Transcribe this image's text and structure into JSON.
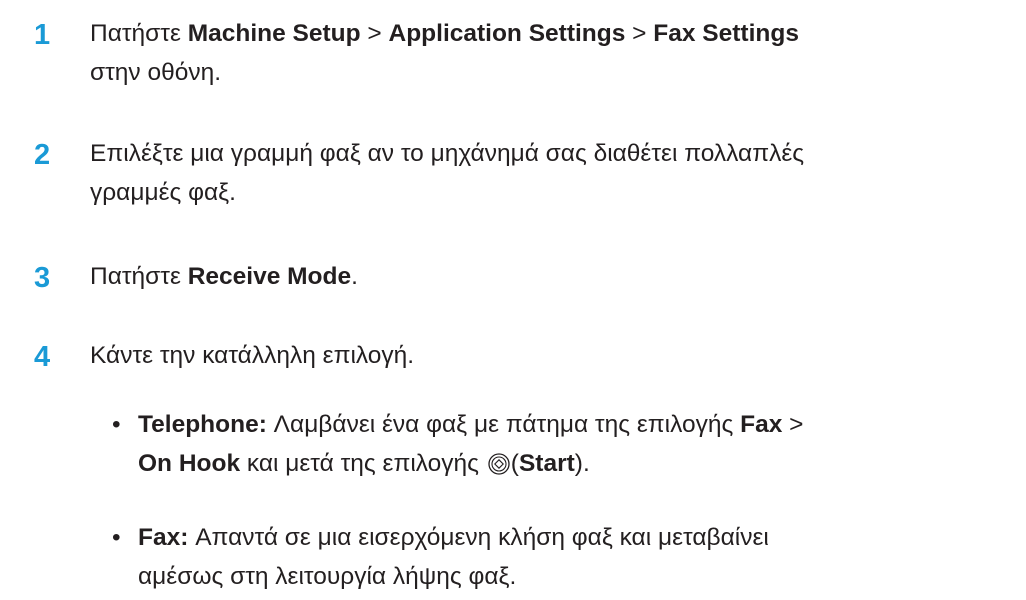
{
  "steps": [
    {
      "number": "1",
      "prefix": "Πατήστε ",
      "path_1": "Machine Setup",
      "sep_1": " > ",
      "path_2": "Application Settings",
      "sep_2": " > ",
      "path_3": "Fax Settings",
      "suffix": "στην οθόνη."
    },
    {
      "number": "2",
      "line_1": "Επιλέξτε μια γραμμή φαξ αν το μηχάνημά σας διαθέτει πολλαπλές",
      "line_2": "γραμμές φαξ."
    },
    {
      "number": "3",
      "prefix": "Πατήστε ",
      "bold": "Receive Mode",
      "suffix": "."
    },
    {
      "number": "4",
      "text": "Κάντε την κατάλληλη επιλογή."
    }
  ],
  "options": [
    {
      "bullet": "•",
      "name": "Telephone:",
      "desc_1": " Λαμβάνει ένα φαξ με πάτημα της επιλογής ",
      "ref_1": "Fax",
      "sep": " >",
      "ref_2": "On Hook",
      "desc_2": " και μετά της επιλογής ",
      "icon": "start-button-icon",
      "open_paren": "(",
      "ref_3": "Start",
      "close_paren": ")."
    },
    {
      "bullet": "•",
      "name": "Fax:",
      "line_1": " Απαντά σε μια εισερχόμενη κλήση φαξ και μεταβαίνει",
      "line_2": "αμέσως στη λειτουργία λήψης φαξ."
    }
  ],
  "colors": {
    "step_number": "#1a9ad6",
    "text": "#231f20"
  }
}
